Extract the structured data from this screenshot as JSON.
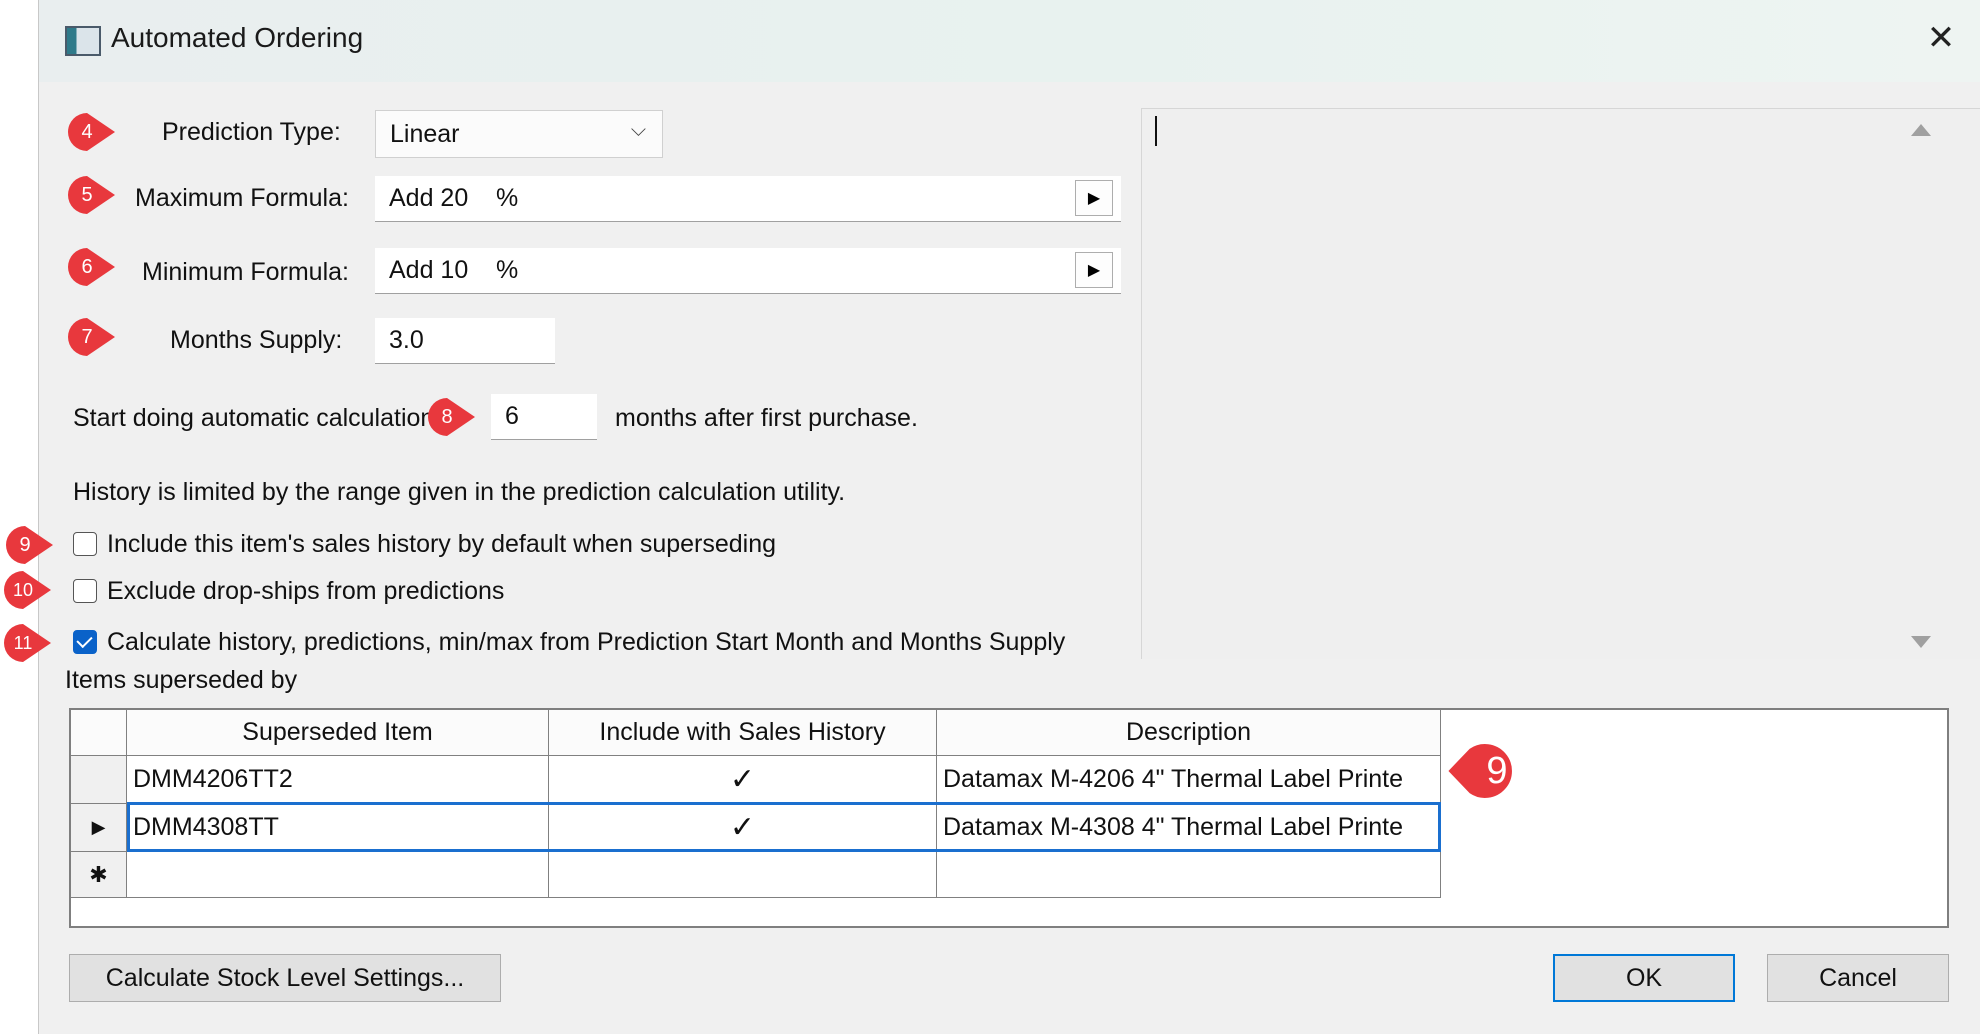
{
  "window": {
    "title": "Automated Ordering"
  },
  "form": {
    "prediction_type_label": "Prediction Type:",
    "prediction_type_value": "Linear",
    "max_formula_label": "Maximum Formula:",
    "max_formula_value": "Add 20    %",
    "min_formula_label": "Minimum Formula:",
    "min_formula_value": "Add 10    %",
    "months_supply_label": "Months Supply:",
    "months_supply_value": "3.0",
    "start_calc_label": "Start doing automatic calculation",
    "start_calc_value": "6",
    "start_calc_suffix": "months after first purchase.",
    "history_note": "History is limited by the range given in the prediction calculation utility."
  },
  "checkboxes": [
    {
      "label": "Include this item's sales history by default when superseding",
      "checked": false
    },
    {
      "label": "Exclude drop-ships from predictions",
      "checked": false
    },
    {
      "label": "Calculate history, predictions, min/max from Prediction Start Month and Months Supply",
      "checked": true
    }
  ],
  "markers": [
    "4",
    "5",
    "6",
    "7",
    "8",
    "9",
    "10",
    "11",
    "9"
  ],
  "grid": {
    "title": "Items superseded by",
    "columns": [
      "Superseded Item",
      "Include with Sales History",
      "Description"
    ],
    "rows": [
      {
        "item": "DMM4206TT2",
        "include": "✓",
        "description": "Datamax M-4206 4\" Thermal Label Printe",
        "selected": false
      },
      {
        "item": "DMM4308TT",
        "include": "✓",
        "description": "Datamax M-4308 4\" Thermal Label Printe",
        "selected": true
      }
    ],
    "new_row_marker": "✱",
    "current_row_marker": "▶"
  },
  "buttons": {
    "calculate": "Calculate Stock Level Settings...",
    "ok": "OK",
    "cancel": "Cancel"
  },
  "colors": {
    "marker": "#e8383d",
    "checkbox_checked": "#0a62c9",
    "selection": "#1a6fcf"
  }
}
